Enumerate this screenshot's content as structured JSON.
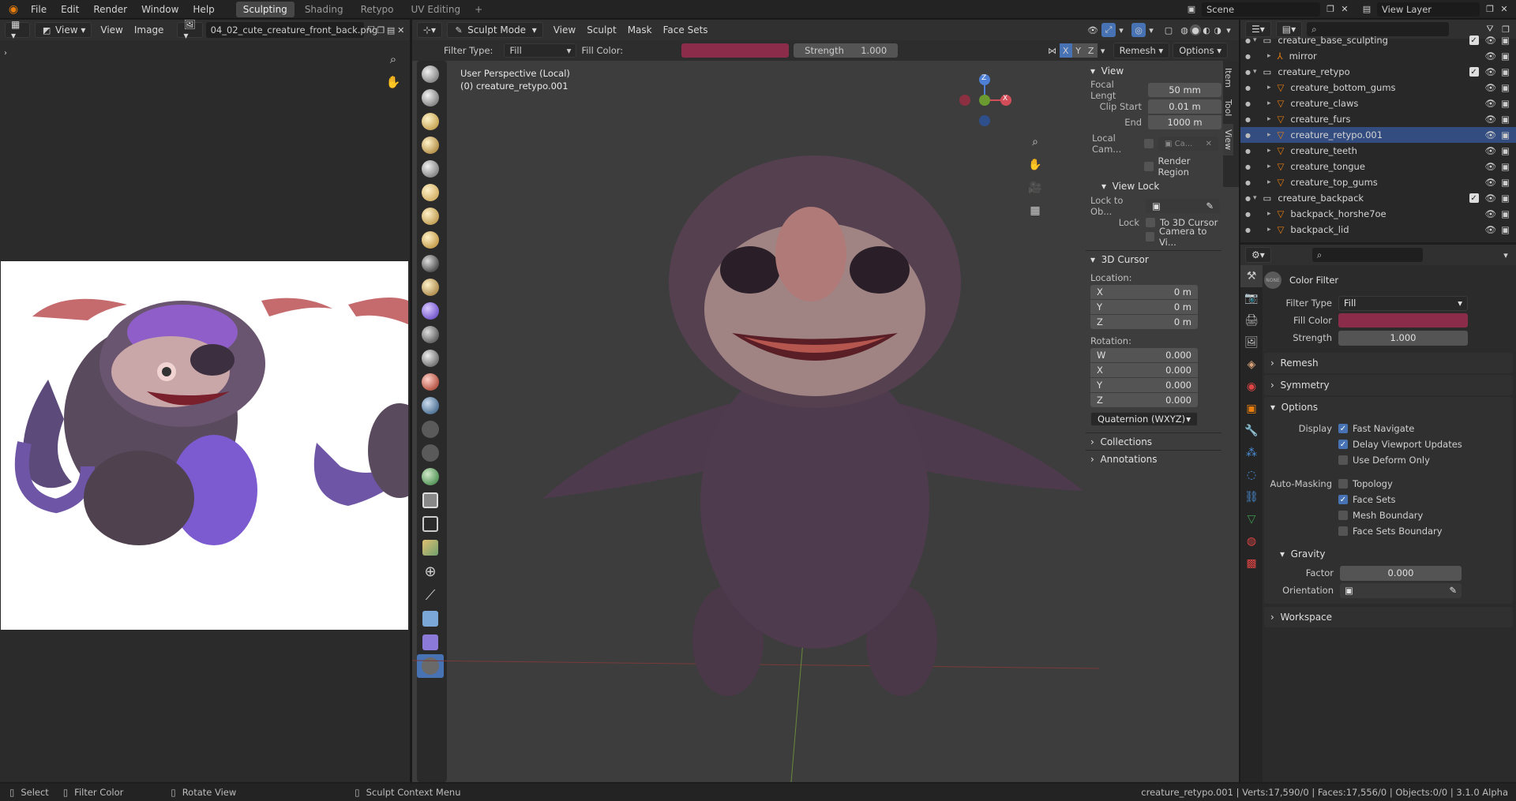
{
  "topbar": {
    "menus": [
      "File",
      "Edit",
      "Render",
      "Window",
      "Help"
    ],
    "workspaces": [
      "Sculpting",
      "Shading",
      "Retypo",
      "UV Editing"
    ],
    "active_workspace": "Sculpting",
    "add_tab": "+",
    "scene": "Scene",
    "view_layer": "View Layer"
  },
  "image_editor": {
    "view_menu": "View",
    "menus": [
      "View",
      "Image"
    ],
    "image_name": "04_02_cute_creature_front_back.png"
  },
  "viewport": {
    "mode": "Sculpt Mode",
    "menus": [
      "View",
      "Sculpt",
      "Mask",
      "Face Sets"
    ],
    "filter_type_label": "Filter Type:",
    "filter_type_value": "Fill",
    "fill_color_label": "Fill Color:",
    "fill_color": "#8b2d4a",
    "strength_label": "Strength",
    "strength_value": "1.000",
    "axes": [
      "X",
      "Y",
      "Z"
    ],
    "remesh": "Remesh",
    "options": "Options",
    "overlay_line1": "User Perspective (Local)",
    "overlay_line2": "(0) creature_retypo.001",
    "side_tabs": [
      "Item",
      "Tool",
      "View"
    ],
    "gizmo": {
      "z": "Z",
      "x": "X"
    }
  },
  "npanel": {
    "view_title": "View",
    "focal_label": "Focal Lengt",
    "focal_value": "50 mm",
    "clip_start_label": "Clip Start",
    "clip_start_value": "0.01 m",
    "end_label": "End",
    "end_value": "1000 m",
    "local_cam_label": "Local Cam...",
    "local_cam_value": "Ca...",
    "render_region": "Render Region",
    "view_lock_title": "View Lock",
    "lock_to_obj_label": "Lock to Ob...",
    "lock_label": "Lock",
    "to_3d_cursor": "To 3D Cursor",
    "camera_to_view": "Camera to Vi...",
    "cursor_title": "3D Cursor",
    "location_label": "Location:",
    "loc": [
      {
        "axis": "X",
        "value": "0 m"
      },
      {
        "axis": "Y",
        "value": "0 m"
      },
      {
        "axis": "Z",
        "value": "0 m"
      }
    ],
    "rotation_label": "Rotation:",
    "rot": [
      {
        "axis": "W",
        "value": "0.000"
      },
      {
        "axis": "X",
        "value": "0.000"
      },
      {
        "axis": "Y",
        "value": "0.000"
      },
      {
        "axis": "Z",
        "value": "0.000"
      }
    ],
    "rot_mode": "Quaternion (WXYZ)",
    "collections": "Collections",
    "annotations": "Annotations"
  },
  "outliner": {
    "rows": [
      {
        "name": "creature_base_sculpting",
        "type": "collection",
        "indent": 0
      },
      {
        "name": "mirror",
        "type": "empty",
        "indent": 1
      },
      {
        "name": "creature_retypo",
        "type": "collection",
        "indent": 0
      },
      {
        "name": "creature_bottom_gums",
        "type": "mesh",
        "indent": 1
      },
      {
        "name": "creature_claws",
        "type": "mesh",
        "indent": 1
      },
      {
        "name": "creature_furs",
        "type": "mesh",
        "indent": 1
      },
      {
        "name": "creature_retypo.001",
        "type": "mesh",
        "indent": 1,
        "selected": true
      },
      {
        "name": "creature_teeth",
        "type": "mesh",
        "indent": 1
      },
      {
        "name": "creature_tongue",
        "type": "mesh",
        "indent": 1
      },
      {
        "name": "creature_top_gums",
        "type": "mesh",
        "indent": 1
      },
      {
        "name": "creature_backpack",
        "type": "collection",
        "indent": 0
      },
      {
        "name": "backpack_horshe7oe",
        "type": "mesh",
        "indent": 1
      },
      {
        "name": "backpack_lid",
        "type": "mesh",
        "indent": 1
      }
    ]
  },
  "properties": {
    "tool_name": "Color Filter",
    "tool_badge": "NONE",
    "filter_type_label": "Filter Type",
    "filter_type_value": "Fill",
    "fill_color_label": "Fill Color",
    "fill_color": "#8b2d4a",
    "strength_label": "Strength",
    "strength_value": "1.000",
    "remesh": "Remesh",
    "symmetry": "Symmetry",
    "options": "Options",
    "display_label": "Display",
    "fast_navigate": "Fast Navigate",
    "delay_viewport": "Delay Viewport Updates",
    "use_deform": "Use Deform Only",
    "automasking_label": "Auto-Masking",
    "topology": "Topology",
    "face_sets": "Face Sets",
    "mesh_boundary": "Mesh Boundary",
    "face_sets_boundary": "Face Sets Boundary",
    "gravity": "Gravity",
    "factor_label": "Factor",
    "factor_value": "0.000",
    "orientation_label": "Orientation",
    "workspace": "Workspace"
  },
  "status": {
    "select": "Select",
    "filter_color": "Filter Color",
    "rotate_view": "Rotate View",
    "context_menu": "Sculpt Context Menu",
    "stats": "creature_retypo.001 | Verts:17,590/0 | Faces:17,556/0 | Objects:0/0 | 3.1.0 Alpha"
  }
}
